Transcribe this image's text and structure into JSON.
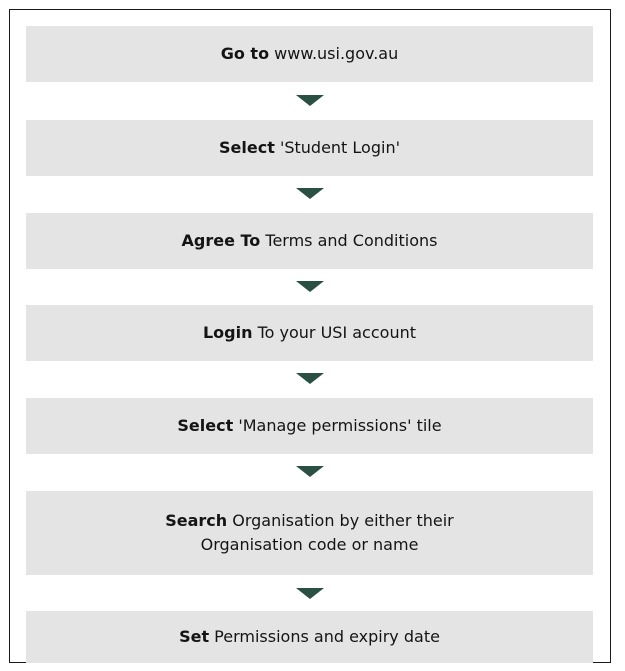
{
  "colors": {
    "step_background": "#e4e4e4",
    "arrow": "#2a5044",
    "border": "#1a1a1a"
  },
  "steps": [
    {
      "bold": "Go to",
      "text": " www.usi.gov.au"
    },
    {
      "bold": "Select",
      "text": " 'Student Login'"
    },
    {
      "bold": "Agree To",
      "text": " Terms and Conditions"
    },
    {
      "bold": "Login",
      "text": " To your USI account"
    },
    {
      "bold": "Select",
      "text": " 'Manage permissions' tile"
    },
    {
      "bold": "Search",
      "text": " Organisation by either their",
      "line2": "Organisation code or name"
    },
    {
      "bold": "Set",
      "text": " Permissions and expiry date"
    }
  ],
  "arrow_icon": "down-triangle-icon"
}
